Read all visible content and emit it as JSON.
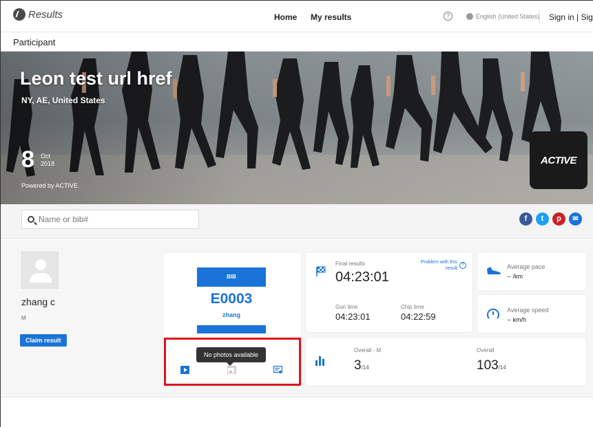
{
  "nav": {
    "brand": "Results",
    "home": "Home",
    "my_results": "My results",
    "help": "?",
    "language": "English (United States)",
    "signin": "Sign in | Sign up"
  },
  "subheader": {
    "title": "Participant"
  },
  "event": {
    "name": "Leon test url href",
    "location": "NY, AE, United States",
    "day": "8",
    "month": "Oct",
    "year": "2018",
    "powered": "Powered by ACTIVE",
    "badge": "ACTIVE"
  },
  "search": {
    "placeholder": "Name or bib#"
  },
  "social": {
    "facebook": "f",
    "twitter": "t",
    "pinterest": "p",
    "email": "✉"
  },
  "participant": {
    "name": "zhang c",
    "gender": "M",
    "claim_label": "Claim result"
  },
  "bib": {
    "header": "BIB",
    "number": "E0003",
    "name": "zhang"
  },
  "media": {
    "tooltip": "No photos available"
  },
  "results": {
    "final_label": "Final results",
    "final_time": "04:23:01",
    "problem_link": "Problem with this result",
    "gun_label": "Gun time",
    "gun_time": "04:23:01",
    "chip_label": "Chip time",
    "chip_time": "04:22:59"
  },
  "pace": {
    "label": "Average pace",
    "value": "-- /km"
  },
  "speed": {
    "label": "Average speed",
    "value": "-- km/h"
  },
  "ranking": {
    "overall_m_label": "Overall - M",
    "overall_m_rank": "3",
    "overall_m_total": "/14",
    "overall_label": "Overall",
    "overall_rank": "103",
    "overall_total": "/14"
  },
  "colors": {
    "accent": "#1a73d9",
    "facebook": "#3b5998",
    "twitter": "#1da1f2",
    "pinterest": "#cb2027",
    "email": "#1a73d9",
    "highlight": "#e0101a"
  }
}
